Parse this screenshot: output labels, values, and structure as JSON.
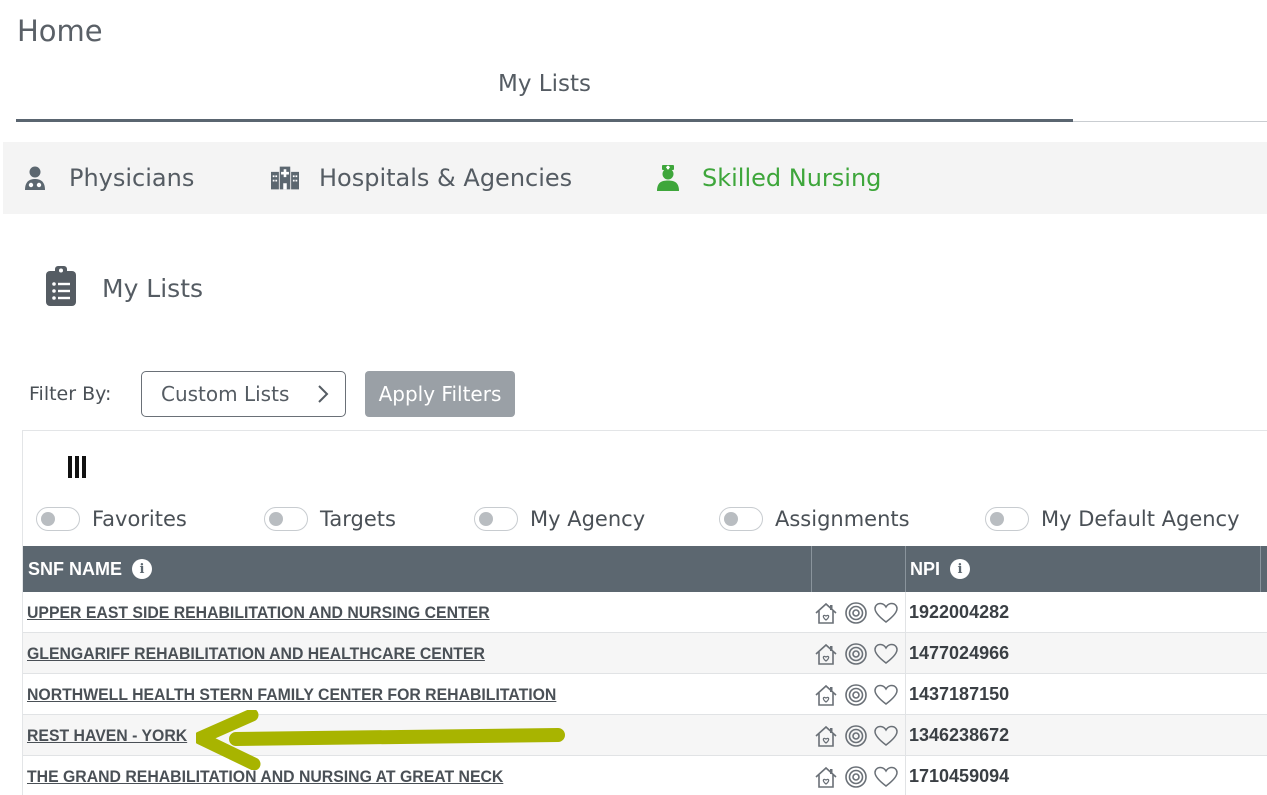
{
  "page": {
    "title": "Home"
  },
  "tabs": {
    "my_lists": "My Lists"
  },
  "categories": [
    {
      "label": "Physicians",
      "icon": "physician-icon"
    },
    {
      "label": "Hospitals & Agencies",
      "icon": "hospital-icon"
    },
    {
      "label": "Skilled Nursing",
      "icon": "nurse-icon",
      "active": true
    }
  ],
  "section": {
    "title": "My Lists",
    "icon": "clipboard-list-icon"
  },
  "filters": {
    "label": "Filter By:",
    "custom_lists": "Custom Lists",
    "apply": "Apply Filters"
  },
  "toggles": [
    {
      "label": "Favorites"
    },
    {
      "label": "Targets"
    },
    {
      "label": "My Agency"
    },
    {
      "label": "Assignments"
    },
    {
      "label": "My Default Agency"
    }
  ],
  "grid": {
    "columns": {
      "name": "SNF NAME",
      "npi": "NPI"
    },
    "rows": [
      {
        "name": "UPPER EAST SIDE REHABILITATION AND NURSING CENTER",
        "npi": "1922004282"
      },
      {
        "name": "GLENGARIFF REHABILITATION AND HEALTHCARE CENTER",
        "npi": "1477024966"
      },
      {
        "name": "NORTHWELL HEALTH STERN FAMILY CENTER FOR REHABILITATION",
        "npi": "1437187150"
      },
      {
        "name": "REST HAVEN - YORK",
        "npi": "1346238672"
      },
      {
        "name": "THE GRAND REHABILITATION AND NURSING AT GREAT NECK",
        "npi": "1710459094"
      }
    ]
  },
  "colors": {
    "accent_green": "#3ea63b",
    "header_bg": "#5c6770",
    "annotation_arrow": "#a8b400"
  }
}
